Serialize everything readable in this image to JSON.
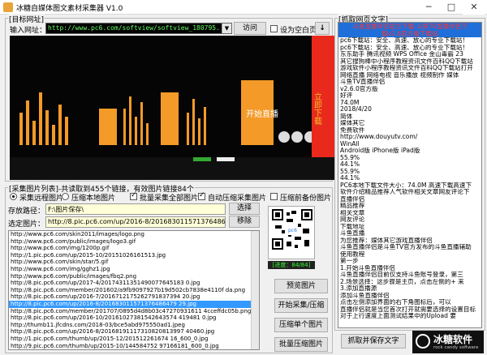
{
  "window": {
    "title": "冰糖自媒体图文素材采集器 V1.0",
    "min": "─",
    "max": "□",
    "close": "✕"
  },
  "target": {
    "legend": "[目标网址]",
    "url_label": "输入网址：",
    "url_value": "http://www.pc6.com/softview/softview_180795.html",
    "visit_button": "访问",
    "blank_check": "设为空白页",
    "download_arrow": "↓"
  },
  "banner": {
    "side_text": "立即下载",
    "small_text": "开始直播",
    "colors": {
      "bg": "#050505",
      "orange": "#f39a28",
      "red": "#e8291c"
    }
  },
  "collect": {
    "legend": "[采集图片列表]-共读取到455个链接，有效图片链接84个",
    "options": [
      {
        "label": "采集远程图片",
        "checked": true,
        "type": "radio"
      },
      {
        "label": "压缩本地图片",
        "checked": false,
        "type": "radio"
      },
      {
        "label": "批量采集全部图片",
        "checked": true,
        "type": "check"
      },
      {
        "label": "自动压缩采集图片",
        "checked": true,
        "type": "check"
      },
      {
        "label": "压缩前备份图片",
        "checked": false,
        "type": "check"
      }
    ],
    "save_path_label": "存放路径：",
    "save_path_value": "F:\\图片保存\\",
    "selected_label": "选定图片：",
    "selected_value": "http://8.pic.pc6.com/up/2016-8/201683011571376486479",
    "choose_button": "选择",
    "remove_button": "移除"
  },
  "images": [
    "http://www.pc6.com/skin2011/images/logo.png",
    "http://www.pc6.com/public/images/logo3.gif",
    "http://www.pc6.com/img/1200p.gif",
    "http://1.pic.pc6.com/up/2015-10/20151026161513.jpg",
    "http://www.pc6.com/skin/star/5.gif",
    "http://www.pc6.com/img/gghz1.jpg",
    "http://www.pc6.com/public/images/fbq2.png",
    "http://8.pic.pc6.com/up/2017-4/20174311351490077645183 0.jpg",
    "http://8.pic.pc6.com/member/201602/a9fb9097927b19d502cb7838e4110f da.png",
    "http://8.pic.pc6.com/up/2016-7/2016712175262791837394 20.jpg",
    "http://8.pic.pc6.com/up/2016-8/201683011571376486479 29.jpg",
    "http://8.pic.pc6.com/member/201707/0895d4d8b03c47270931611 4cceffdc05b.png",
    "http://8.pic.pc6.com/up/2016-10/20161027381542643574 419481 0.jpg",
    "http://thumb11.jfcdns.com/2018-03/bce5abd975550ad1.jpeg",
    "http://8.pic.pc6.com/up/2016-8/20168191117310820813997 40460.jpg",
    "http://1.pic.pc6.com/thumb/up/2015-12/201512261674 16_600_0.jpg",
    "http://9.pic.pc6.com/thumb/up/2015-10/144584752 97166181_600_0.jpg",
    "http://1.pic.pc6.com/thumb/up/2015-10/20151026162422548_600_0.jpg",
    "http://2.pic.pc6.com/thumb/up/2015-10/201510261607494 01_600_0.jpg"
  ],
  "selected_index": 10,
  "qr": {
    "count_text": "[进度：84/84]"
  },
  "actions": {
    "preview": "预览图片",
    "start": "开始采集/压缩",
    "compress_one": "压缩单个图片",
    "compress_batch": "批量压缩图片"
  },
  "capture": {
    "legend": "[抓取网页文字]",
    "headline1": "斗鱼直播伴侣官方下载-斗鱼TV直播伴侣下",
    "headline2": "载v2.6官方版下载站",
    "lines": [
      "pc6下载站：安全、高速、放心的专业下载站！",
      "pc6下载站：安全、高速、放心的专业下载站！",
      "东东助手 腾讯视频 WPS Office 金山毒霸 23",
      "其它搜狗棒中小程序教程资讯文件百科QQ下载站",
      "游戏软件小程序教程资讯文件百科QQ下载站打开",
      "网络直播 网络电视 音乐播放 视频制作 媒体",
      "斗鱼TV直播伴侣",
      "v2.6.0官方版",
      "好评",
      "74.0M",
      "2018/4/20",
      "简体",
      "媒体其它",
      "免费软件",
      "http://www.douyutv.com/",
      "WinAll",
      "Android版 iPhone版 iPad版",
      "55.9%",
      "44.1%",
      "55.9%",
      "44.1%",
      "PC6本地下载文件大小：74.0M 高速下载高速下",
      "软件介绍精品推荐人气软件相关文章网友评论下",
      "直播伴侣",
      "精品推荐",
      "相关文章",
      "网友评论",
      "下载地址",
      "斗鱼直播",
      "为您推荐：媒体其它游戏直播伴侣",
      "斗鱼直播伴侣是斗鱼TV官方发布的斗鱼直播辅助",
      "使用教程",
      "第一步",
      "1.开始斗鱼直播伴侣",
      "斗鱼直播伴侣目前仅支持斗鱼账号登录，第三",
      "2.场景选择：这步骤是主页，点击左侧的+ 来",
      "3.添加直播源",
      "添加斗鱼直播伴侣",
      "点击左侧添加界面的右下角图标后，可以",
      "直播伴侣就是当您首次打开就需要选择的设置目标",
      "对于上行速度上面测试结果中的Upload 要"
    ],
    "save_button": "抓取并保存文字"
  },
  "logo": {
    "name": "冰糖软件",
    "sub": "rock candy software"
  }
}
